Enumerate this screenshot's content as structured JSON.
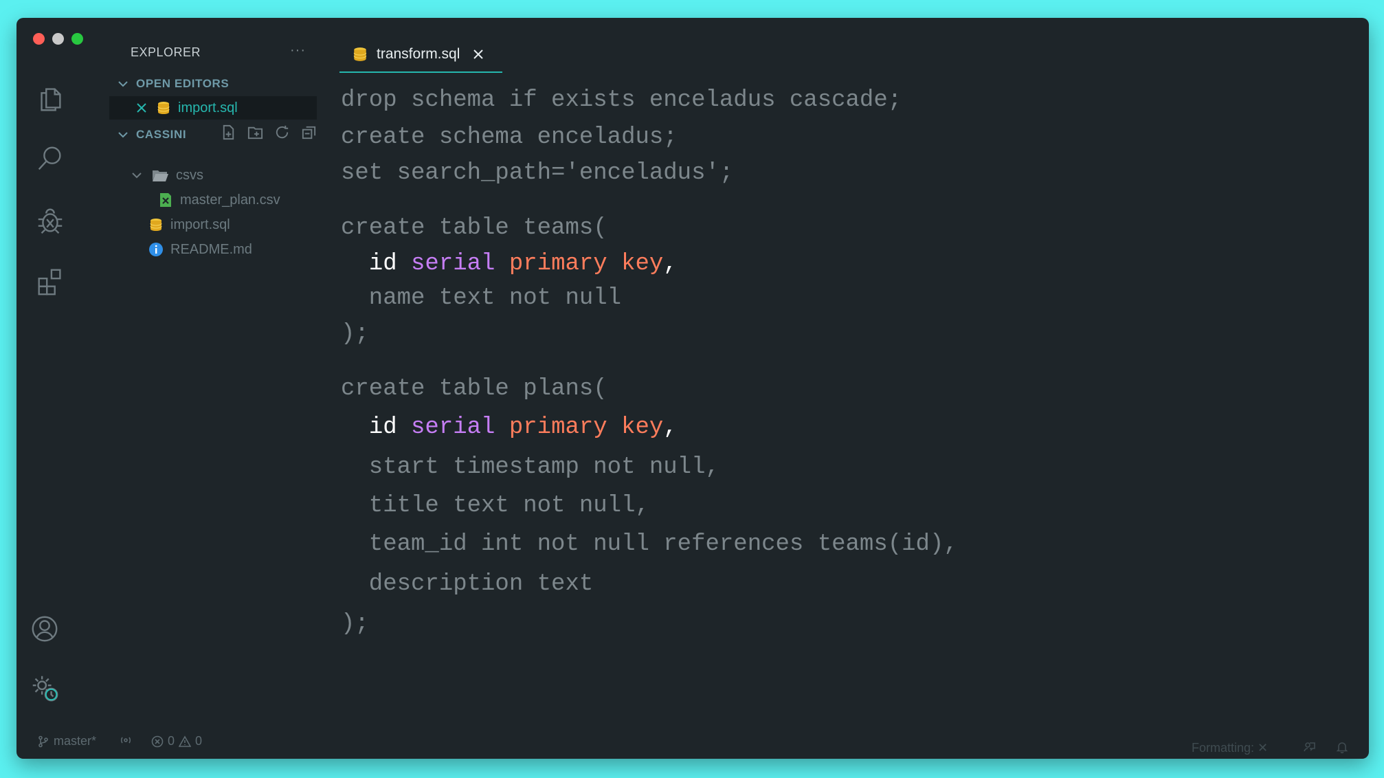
{
  "window": {
    "traffic_lights": [
      "close",
      "minimize",
      "maximize"
    ]
  },
  "activity_bar": {
    "icons": [
      "files-icon",
      "search-icon",
      "debug-icon",
      "extensions-icon",
      "account-icon",
      "settings-icon"
    ]
  },
  "sidebar": {
    "title": "EXPLORER",
    "more": "···",
    "open_editors": {
      "label": "OPEN EDITORS",
      "items": [
        {
          "name": "import.sql"
        }
      ]
    },
    "project": {
      "label": "CASSINI",
      "tree": [
        {
          "name": "csvs"
        },
        {
          "name": "master_plan.csv"
        },
        {
          "name": "import.sql"
        },
        {
          "name": "README.md"
        }
      ]
    }
  },
  "tab": {
    "name": "transform.sql"
  },
  "editor": {
    "lines": [
      "drop schema if exists enceladus cascade;",
      "create schema enceladus;",
      "set search_path='enceladus';",
      "create table teams(",
      [
        "id",
        "serial",
        "primary key",
        ","
      ],
      "  name text not null",
      ");",
      "create table plans(",
      [
        "id",
        "serial",
        "primary key",
        ","
      ],
      "  start timestamp not null,",
      "  title text not null,",
      "  team_id int not null references teams(id),",
      "  description text",
      ");"
    ]
  },
  "status": {
    "branch": "master*",
    "errors": "0",
    "warnings": "0",
    "formatting": "Formatting: ✕"
  },
  "colors": {
    "accent": "#26b7ae",
    "keyword_purple": "#c67ef5",
    "keyword_orange": "#ff7d5c",
    "background": "#1e2529"
  }
}
